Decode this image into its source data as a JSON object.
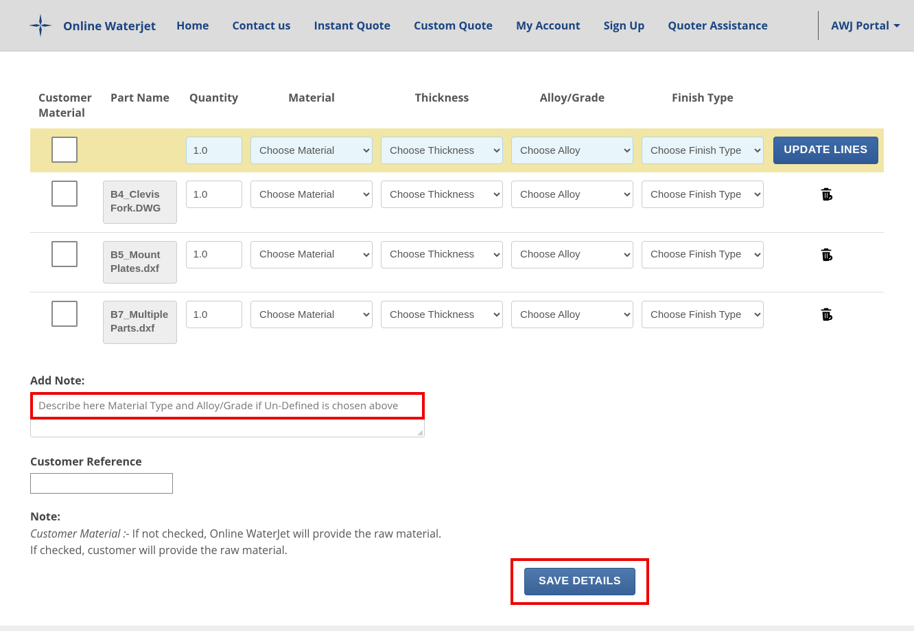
{
  "nav": {
    "brand": "Online Waterjet",
    "links": [
      "Home",
      "Contact us",
      "Instant Quote",
      "Custom Quote",
      "My Account",
      "Sign Up",
      "Quoter Assistance"
    ],
    "portal": "AWJ Portal"
  },
  "table": {
    "headers": {
      "customer_material": "Customer Material",
      "part_name": "Part Name",
      "quantity": "Quantity",
      "material": "Material",
      "thickness": "Thickness",
      "alloy": "Alloy/Grade",
      "finish": "Finish Type"
    },
    "options": {
      "material": "Choose Material",
      "thickness": "Choose Thickness",
      "alloy": "Choose Alloy",
      "finish": "Choose Finish Type"
    },
    "update_button": "UPDATE LINES",
    "master_row": {
      "quantity": "1.0"
    },
    "rows": [
      {
        "part_name": "B4_Clevis Fork.DWG",
        "quantity": "1.0"
      },
      {
        "part_name": "B5_Mount Plates.dxf",
        "quantity": "1.0"
      },
      {
        "part_name": "B7_Multiple Parts.dxf",
        "quantity": "1.0"
      }
    ]
  },
  "add_note": {
    "label": "Add Note:",
    "placeholder": "Describe here Material Type and Alloy/Grade if Un-Defined is chosen above"
  },
  "customer_reference": {
    "label": "Customer Reference"
  },
  "note": {
    "title": "Note:",
    "line1_emph": "Customer Material :-",
    "line1_rest": " If not checked, Online WaterJet will provide the raw material.",
    "line2": "If checked, customer will provide the raw material."
  },
  "save_button": "SAVE DETAILS"
}
